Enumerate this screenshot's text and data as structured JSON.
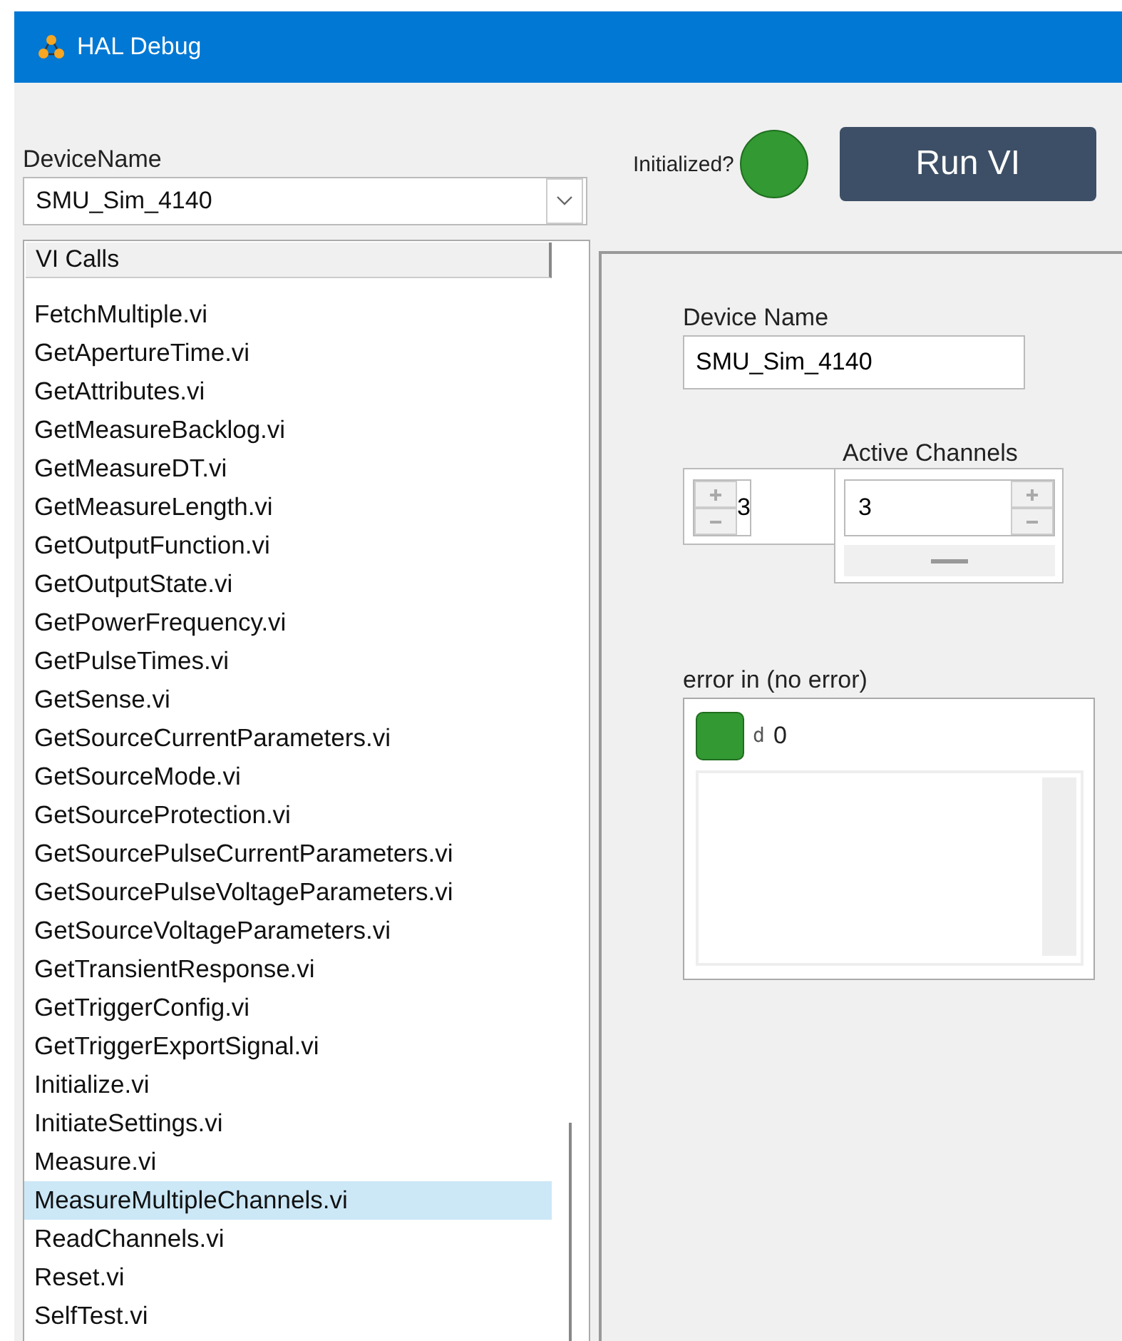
{
  "window": {
    "title": "HAL Debug"
  },
  "device_selector": {
    "label": "DeviceName",
    "value": "SMU_Sim_4140"
  },
  "initialized": {
    "label": "Initialized?",
    "on": true
  },
  "run_button": {
    "label": "Run VI"
  },
  "vi_list": {
    "header": "VI Calls",
    "items": [
      {
        "label": "FetchMultiple.vi",
        "selected": false
      },
      {
        "label": "GetApertureTime.vi",
        "selected": false
      },
      {
        "label": "GetAttributes.vi",
        "selected": false
      },
      {
        "label": "GetMeasureBacklog.vi",
        "selected": false
      },
      {
        "label": "GetMeasureDT.vi",
        "selected": false
      },
      {
        "label": "GetMeasureLength.vi",
        "selected": false
      },
      {
        "label": "GetOutputFunction.vi",
        "selected": false
      },
      {
        "label": "GetOutputState.vi",
        "selected": false
      },
      {
        "label": "GetPowerFrequency.vi",
        "selected": false
      },
      {
        "label": "GetPulseTimes.vi",
        "selected": false
      },
      {
        "label": "GetSense.vi",
        "selected": false
      },
      {
        "label": "GetSourceCurrentParameters.vi",
        "selected": false
      },
      {
        "label": "GetSourceMode.vi",
        "selected": false
      },
      {
        "label": "GetSourceProtection.vi",
        "selected": false
      },
      {
        "label": "GetSourcePulseCurrentParameters.vi",
        "selected": false
      },
      {
        "label": "GetSourcePulseVoltageParameters.vi",
        "selected": false
      },
      {
        "label": "GetSourceVoltageParameters.vi",
        "selected": false
      },
      {
        "label": "GetTransientResponse.vi",
        "selected": false
      },
      {
        "label": "GetTriggerConfig.vi",
        "selected": false
      },
      {
        "label": "GetTriggerExportSignal.vi",
        "selected": false
      },
      {
        "label": "Initialize.vi",
        "selected": false
      },
      {
        "label": "InitiateSettings.vi",
        "selected": false
      },
      {
        "label": "Measure.vi",
        "selected": false
      },
      {
        "label": "MeasureMultipleChannels.vi",
        "selected": true
      },
      {
        "label": "ReadChannels.vi",
        "selected": false
      },
      {
        "label": "Reset.vi",
        "selected": false
      },
      {
        "label": "SelfTest.vi",
        "selected": false
      }
    ]
  },
  "panel": {
    "device_name": {
      "label": "Device Name",
      "value": "SMU_Sim_4140"
    },
    "active_channels": {
      "label": "Active Channels",
      "index": "3",
      "value": "3"
    },
    "error_in": {
      "label": "error in (no error)",
      "status_ok": true,
      "code_prefix": "d",
      "code": "0"
    }
  }
}
